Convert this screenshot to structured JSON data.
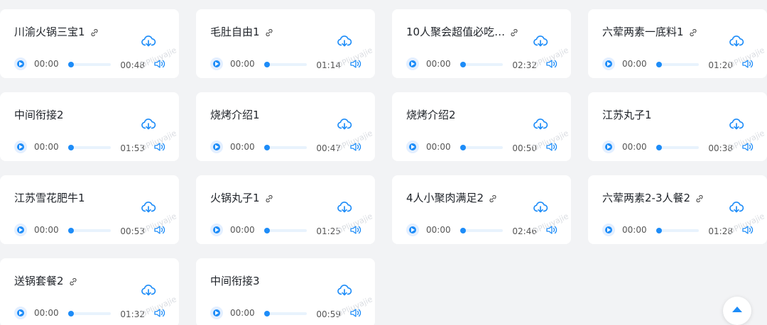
{
  "watermark": "DPliuyajie",
  "cards": [
    {
      "title": "川渝火锅三宝1",
      "link": true,
      "current": "00:00",
      "duration": "00:48"
    },
    {
      "title": "毛肚自由1",
      "link": true,
      "current": "00:00",
      "duration": "01:14"
    },
    {
      "title": "10人聚会超值必吃…",
      "link": true,
      "current": "00:00",
      "duration": "02:32"
    },
    {
      "title": "六荤两素一底料1",
      "link": true,
      "current": "00:00",
      "duration": "01:20"
    },
    {
      "title": "中间衔接2",
      "link": false,
      "current": "00:00",
      "duration": "01:53"
    },
    {
      "title": "烧烤介绍1",
      "link": false,
      "current": "00:00",
      "duration": "00:47"
    },
    {
      "title": "烧烤介绍2",
      "link": false,
      "current": "00:00",
      "duration": "00:50"
    },
    {
      "title": "江苏丸子1",
      "link": false,
      "current": "00:00",
      "duration": "00:38"
    },
    {
      "title": "江苏雪花肥牛1",
      "link": false,
      "current": "00:00",
      "duration": "00:53"
    },
    {
      "title": "火锅丸子1",
      "link": true,
      "current": "00:00",
      "duration": "01:25"
    },
    {
      "title": "4人小聚肉满足2",
      "link": true,
      "current": "00:00",
      "duration": "02:46"
    },
    {
      "title": "六荤两素2-3人餐2",
      "link": true,
      "current": "00:00",
      "duration": "01:28"
    },
    {
      "title": "送锅套餐2",
      "link": true,
      "current": "00:00",
      "duration": "01:32"
    },
    {
      "title": "中间衔接3",
      "link": false,
      "current": "00:00",
      "duration": "00:59"
    }
  ],
  "colors": {
    "accent": "#1d8cf8",
    "card": "#ffffff",
    "background": "#f2f3f5"
  },
  "icons": {
    "download": "cloud-download-icon",
    "link": "link-icon",
    "play": "play-icon",
    "volume": "volume-icon",
    "scroll_top": "arrow-up-icon"
  }
}
